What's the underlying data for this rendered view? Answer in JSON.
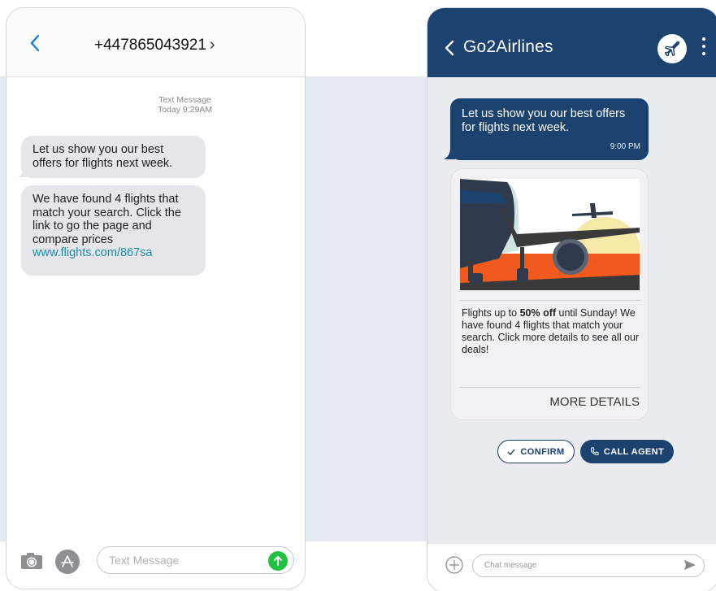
{
  "sms": {
    "contact": "+447865043921",
    "contact_chevron": "›",
    "meta_line1": "Text Message",
    "meta_line2": "Today 9:29AM",
    "messages": [
      {
        "text": "Let us show you our best offers for flights next week."
      },
      {
        "text": "We have found 4 flights that match your search. Click the link to go the page and compare prices",
        "link": "www.flights.com/867sa"
      }
    ],
    "input_placeholder": "Text Message",
    "icons": [
      "back-chevron-icon",
      "camera-icon",
      "app-store-icon",
      "send-arrow-icon"
    ],
    "colors": {
      "accent": "#1a8ea8",
      "send": "#20c040",
      "bubble": "#e5e5ea",
      "back": "#1a7fe0"
    }
  },
  "rcs": {
    "agent_name": "Go2Airlines",
    "message": "Let us show you our best offers for flights next week.",
    "message_time": "9:00 PM",
    "card": {
      "text_prefix": "Flights up to ",
      "text_bold": "50% off",
      "text_suffix": " until Sunday! We have found 4 flights that match your search. Click more details to see all our deals!",
      "action": "MORE DETAILS"
    },
    "chips": [
      {
        "label": "CONFIRM",
        "icon": "check-icon"
      },
      {
        "label": "CALL AGENT",
        "icon": "phone-icon"
      }
    ],
    "input_placeholder": "Chat message",
    "icons": [
      "back-chevron-icon",
      "plane-logo-icon",
      "more-vert-icon",
      "add-circle-icon",
      "send-icon"
    ],
    "colors": {
      "brand": "#1c4270",
      "orange": "#f15a1f",
      "sun": "#f5e9a8"
    }
  }
}
